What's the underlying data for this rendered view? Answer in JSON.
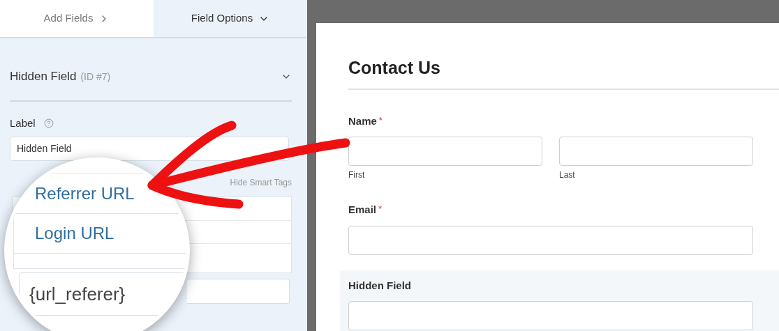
{
  "sidebar": {
    "tabs": [
      {
        "label": "Add Fields",
        "selected": false
      },
      {
        "label": "Field Options",
        "selected": true
      }
    ],
    "field_options": {
      "title": "Hidden Field",
      "id_label": "(ID #7)",
      "label_caption": "Label",
      "label_value": "Hidden Field",
      "smart_tags_toggle": "Hide Smart Tags"
    },
    "magnifier": {
      "smart_tags": [
        "Referrer URL",
        "Login URL"
      ],
      "default_value": "{url_referer}"
    }
  },
  "form": {
    "title": "Contact Us",
    "required_mark": "*",
    "fields": [
      {
        "kind": "name",
        "label": "Name",
        "required": true,
        "sublabels": [
          "First",
          "Last"
        ],
        "highlighted": false
      },
      {
        "kind": "email",
        "label": "Email",
        "required": true,
        "highlighted": false
      },
      {
        "kind": "hidden",
        "label": "Hidden Field",
        "required": false,
        "highlighted": true
      }
    ]
  }
}
